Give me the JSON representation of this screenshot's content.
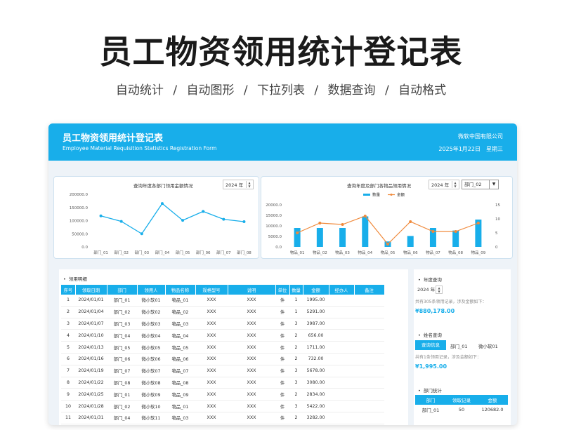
{
  "promo": {
    "title": "员工物资领用统计登记表",
    "features": [
      "自动统计",
      "自动图形",
      "下拉列表",
      "数据查询",
      "自动格式"
    ],
    "separator": "/"
  },
  "header": {
    "title": "员工物资领用统计登记表",
    "subtitle": "Employee Material Requisition Statistics Registration Form",
    "company": "微软中国有限公司",
    "date": "2025年1月22日",
    "weekday": "星期三"
  },
  "chart1": {
    "title": "查询年度各部门领用金额情况",
    "year": "2024 年"
  },
  "chart2": {
    "title": "查询年度及部门各物品领用情况",
    "year": "2024 年",
    "department": "部门_02"
  },
  "chart_data": [
    {
      "type": "line",
      "title": "查询年度各部门领用金额情况",
      "categories": [
        "部门_01",
        "部门_02",
        "部门_03",
        "部门_04",
        "部门_05",
        "部门_06",
        "部门_07",
        "部门_08"
      ],
      "values": [
        118000,
        97000,
        50000,
        165000,
        101000,
        135000,
        105000,
        96000
      ],
      "ylim": [
        0,
        200000
      ],
      "yticks": [
        "200000.0",
        "150000.0",
        "100000.0",
        "50000.0",
        "0.0"
      ],
      "ytick_values": [
        200000,
        150000,
        100000,
        50000,
        0
      ],
      "color": "#18aeea"
    },
    {
      "type": "bar",
      "title": "查询年度及部门各物品领用情况",
      "legend_position": "top",
      "categories": [
        "物品_01",
        "物品_02",
        "物品_03",
        "物品_04",
        "物品_05",
        "物品_06",
        "物品_07",
        "物品_08",
        "物品_09"
      ],
      "series": [
        {
          "name": "数量",
          "axis": "left",
          "kind": "bar",
          "color": "#18aeea",
          "values": [
            9000,
            9000,
            9000,
            14500,
            2600,
            5200,
            9000,
            7800,
            13000
          ]
        },
        {
          "name": "金额",
          "axis": "right",
          "kind": "line",
          "color": "#f08a3c",
          "values": [
            5,
            8.5,
            8,
            11,
            1,
            9,
            5.5,
            5.5,
            8.5
          ]
        }
      ],
      "ylim_left": [
        0,
        20000
      ],
      "yticks_left": [
        "20000.0",
        "15000.0",
        "10000.0",
        "5000.0",
        "0.0"
      ],
      "ytick_values_left": [
        20000,
        15000,
        10000,
        5000,
        0
      ],
      "ylim_right": [
        0,
        15
      ],
      "yticks_right": [
        "15",
        "10",
        "5",
        "0"
      ],
      "ytick_values_right": [
        15,
        10,
        5,
        0
      ]
    }
  ],
  "table": {
    "section_label": "领用明细",
    "headers": [
      "序号",
      "领取日期",
      "部门",
      "领用人",
      "物品名称",
      "规格型号",
      "说明",
      "单位",
      "数量",
      "金额",
      "经办人",
      "备注"
    ],
    "rows": [
      [
        "1",
        "2024/01/01",
        "部门_01",
        "微小软01",
        "物品_01",
        "XXX",
        "XXX",
        "件",
        "1",
        "1995.00",
        "",
        ""
      ],
      [
        "2",
        "2024/01/04",
        "部门_02",
        "微小软02",
        "物品_02",
        "XXX",
        "XXX",
        "件",
        "1",
        "5291.00",
        "",
        ""
      ],
      [
        "3",
        "2024/01/07",
        "部门_03",
        "微小软03",
        "物品_03",
        "XXX",
        "XXX",
        "件",
        "3",
        "3987.00",
        "",
        ""
      ],
      [
        "4",
        "2024/01/10",
        "部门_04",
        "微小软04",
        "物品_04",
        "XXX",
        "XXX",
        "件",
        "2",
        "656.00",
        "",
        ""
      ],
      [
        "5",
        "2024/01/13",
        "部门_05",
        "微小软05",
        "物品_05",
        "XXX",
        "XXX",
        "件",
        "2",
        "1711.00",
        "",
        ""
      ],
      [
        "6",
        "2024/01/16",
        "部门_06",
        "微小软06",
        "物品_06",
        "XXX",
        "XXX",
        "件",
        "2",
        "732.00",
        "",
        ""
      ],
      [
        "7",
        "2024/01/19",
        "部门_07",
        "微小软07",
        "物品_07",
        "XXX",
        "XXX",
        "件",
        "3",
        "5678.00",
        "",
        ""
      ],
      [
        "8",
        "2024/01/22",
        "部门_08",
        "微小软08",
        "物品_08",
        "XXX",
        "XXX",
        "件",
        "3",
        "3080.00",
        "",
        ""
      ],
      [
        "9",
        "2024/01/25",
        "部门_01",
        "微小软09",
        "物品_09",
        "XXX",
        "XXX",
        "件",
        "2",
        "2834.00",
        "",
        ""
      ],
      [
        "10",
        "2024/01/28",
        "部门_02",
        "微小软10",
        "物品_01",
        "XXX",
        "XXX",
        "件",
        "3",
        "5422.00",
        "",
        ""
      ],
      [
        "11",
        "2024/01/31",
        "部门_04",
        "微小软11",
        "物品_03",
        "XXX",
        "XXX",
        "件",
        "2",
        "3282.00",
        "",
        ""
      ]
    ]
  },
  "year_query": {
    "label": "年度查询",
    "year": "2024 年",
    "summary": "共有305条领用记录，涉及金额如下：",
    "amount": "¥880,178.00"
  },
  "name_query": {
    "label": "姓名查询",
    "button": "查询信息",
    "department": "部门_01",
    "person": "微小软01",
    "summary": "共有1条领用记录，涉及金额如下：",
    "amount": "¥1,995.00"
  },
  "dept_stats": {
    "label": "部门统计",
    "headers": [
      "部门",
      "领取记录",
      "金额"
    ],
    "rows": [
      [
        "部门_01",
        "50",
        "120682.0"
      ]
    ]
  }
}
